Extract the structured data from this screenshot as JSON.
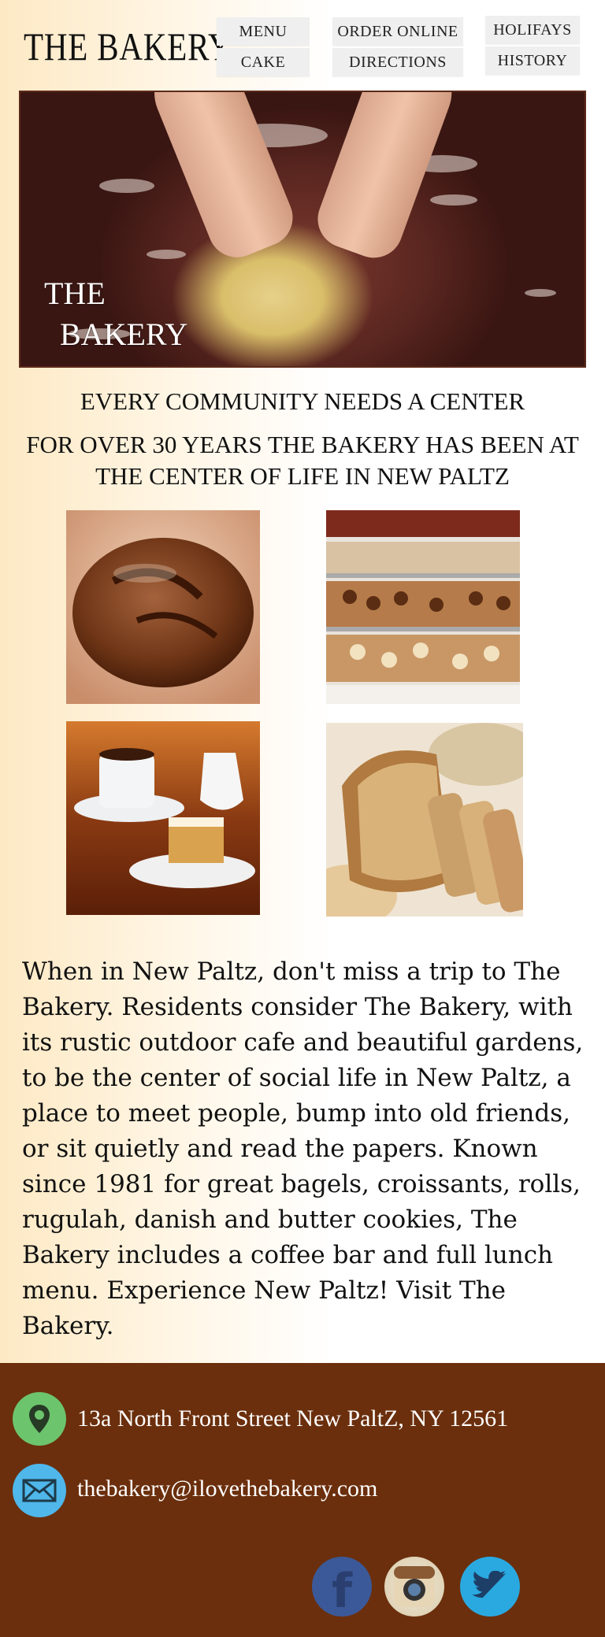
{
  "header": {
    "logo": "THE BAKERY",
    "nav": [
      {
        "label": "MENU",
        "id": "menu"
      },
      {
        "label": "CAKE",
        "id": "cake"
      },
      {
        "label": "ORDER ONLINE",
        "id": "order-online"
      },
      {
        "label": "DIRECTIONS",
        "id": "directions"
      },
      {
        "label": "HOLIFAYS",
        "id": "holifays"
      },
      {
        "label": "HISTORY",
        "id": "history"
      }
    ]
  },
  "hero": {
    "title_line1": "THE",
    "title_line2": "BAKERY"
  },
  "main": {
    "heading1": "EVERY COMMUNITY NEEDS A CENTER",
    "heading2_line1": "FOR OVER 30 YEARS THE BAKERY HAS BEEN AT",
    "heading2_line2": "THE CENTER OF LIFE IN NEW PALTZ",
    "gallery": [
      "bread-loaf-photo",
      "pastry-case-photo",
      "coffee-cake-photo",
      "sliced-bread-photo"
    ],
    "paragraph": "When in New Paltz, don't miss a trip to The Bakery. Residents consider The Bakery, with its rustic outdoor cafe and beautiful gardens, to be the center of social life in New Paltz,  a place to meet people, bump into old friends, or sit quietly and read the papers. Known since 1981 for great bagels, croissants, rolls, rugulah, danish and butter cookies, The Bakery includes a coffee bar and full lunch menu. Experience New Paltz! Visit The Bakery."
  },
  "footer": {
    "address": "13a North Front Street New PaltZ, NY 12561",
    "email": "thebakery@ilovethebakery.com",
    "social": [
      "facebook-icon",
      "instagram-icon",
      "twitter-icon"
    ]
  },
  "colors": {
    "footer_bg": "#6b2f0d",
    "location_icon_bg": "#6cc46c",
    "mail_icon_bg": "#4fb7ea",
    "facebook": "#3b5998",
    "twitter": "#2aa9e0"
  }
}
